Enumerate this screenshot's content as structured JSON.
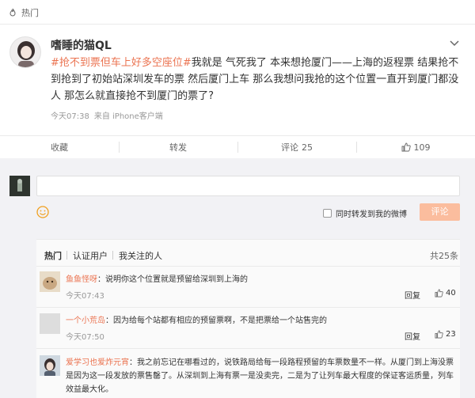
{
  "header": {
    "label": "热门"
  },
  "post": {
    "username": "嗜睡的猫QL",
    "topic": "#抢不到票但车上好多空座位#",
    "text": "我就是 气死我了 本来想抢厦门——上海的返程票 结果抢不到抢到了初始站深圳发车的票 然后厦门上车 那么我想问我抢的这个位置一直开到厦门都没人 那怎么就直接抢不到厦门的票了?",
    "time": "今天07:38",
    "source": "来自 iPhone客户端"
  },
  "actions": {
    "favorite": "收藏",
    "repost": "转发",
    "comment_label": "评论",
    "comment_count": "25",
    "like_count": "109"
  },
  "composer": {
    "placeholder": "",
    "forward_label": "同时转发到我的微博",
    "submit_label": "评论"
  },
  "comments_tabs": {
    "hot": "热门",
    "verified": "认证用户",
    "followed": "我关注的人",
    "total": "共25条"
  },
  "comments": [
    {
      "name": "鱼鱼怪呀",
      "text": "：说明你这个位置就是预留给深圳到上海的",
      "time": "今天07:43",
      "reply": "回复",
      "likes": "40"
    },
    {
      "name": "一个小荒岛",
      "text": "：因为给每个站都有相应的预留票啊，不是把票给一个站售完的",
      "time": "今天07:50",
      "reply": "回复",
      "likes": "23"
    },
    {
      "name": "爱学习也爱炸元宵",
      "text": "：我之前忘记在哪看过的，说铁路局给每一段路程预留的车票数量不一样。从厦门到上海没票是因为这一段发放的票售罄了。从深圳到上海有票一是没卖完，二是为了让列车最大程度的保证客运质量，列车效益最大化。"
    }
  ],
  "colors": {
    "accent": "#eb7350",
    "submit_disabled": "#fbbd9e",
    "background": "#f2f2f5"
  }
}
